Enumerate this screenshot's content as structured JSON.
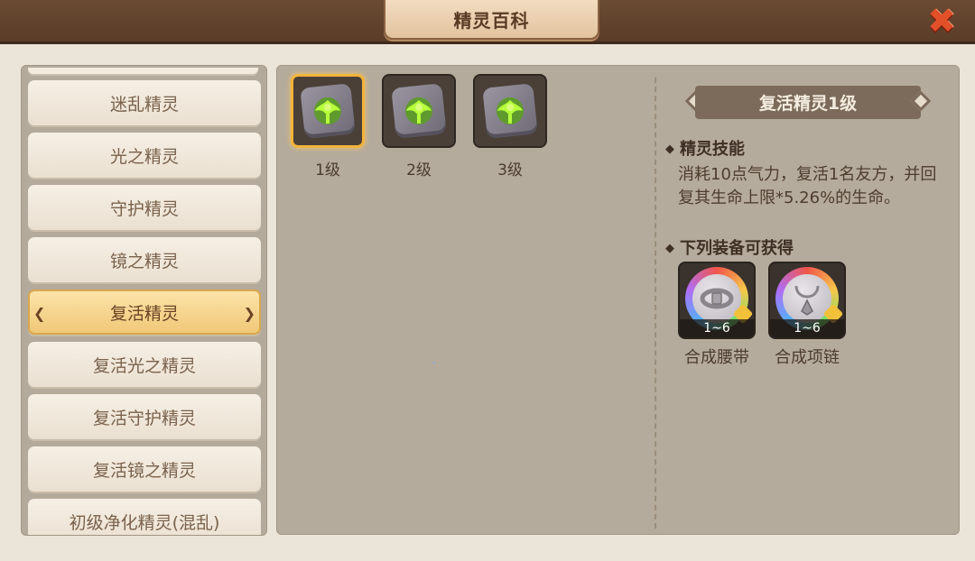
{
  "window": {
    "title": "精灵百科"
  },
  "sprite_list": {
    "items": [
      {
        "label": "迷乱精灵",
        "active": false
      },
      {
        "label": "光之精灵",
        "active": false
      },
      {
        "label": "守护精灵",
        "active": false
      },
      {
        "label": "镜之精灵",
        "active": false
      },
      {
        "label": "复活精灵",
        "active": true
      },
      {
        "label": "复活光之精灵",
        "active": false
      },
      {
        "label": "复活守护精灵",
        "active": false
      },
      {
        "label": "复活镜之精灵",
        "active": false
      },
      {
        "label": "初级净化精灵(混乱)",
        "active": false
      }
    ]
  },
  "levels": [
    {
      "label": "1级",
      "selected": true,
      "icon": "green-spirit-rune-icon"
    },
    {
      "label": "2级",
      "selected": false,
      "icon": "green-spirit-rune-icon"
    },
    {
      "label": "3级",
      "selected": false,
      "icon": "green-spirit-rune-icon"
    }
  ],
  "detail": {
    "title": "复活精灵1级",
    "skill_heading": "精灵技能",
    "skill_description": "消耗10点气力，复活1名友方，并回复其生命上限*5.26%的生命。",
    "equip_heading": "下列装备可获得",
    "equipment": [
      {
        "name": "合成腰带",
        "range": "1~6",
        "icon": "belt-icon"
      },
      {
        "name": "合成项链",
        "range": "1~6",
        "icon": "necklace-icon"
      }
    ]
  },
  "colors": {
    "active_item": "#f0c878",
    "selected_border": "#f3b33a",
    "close_red": "#e2502a"
  }
}
